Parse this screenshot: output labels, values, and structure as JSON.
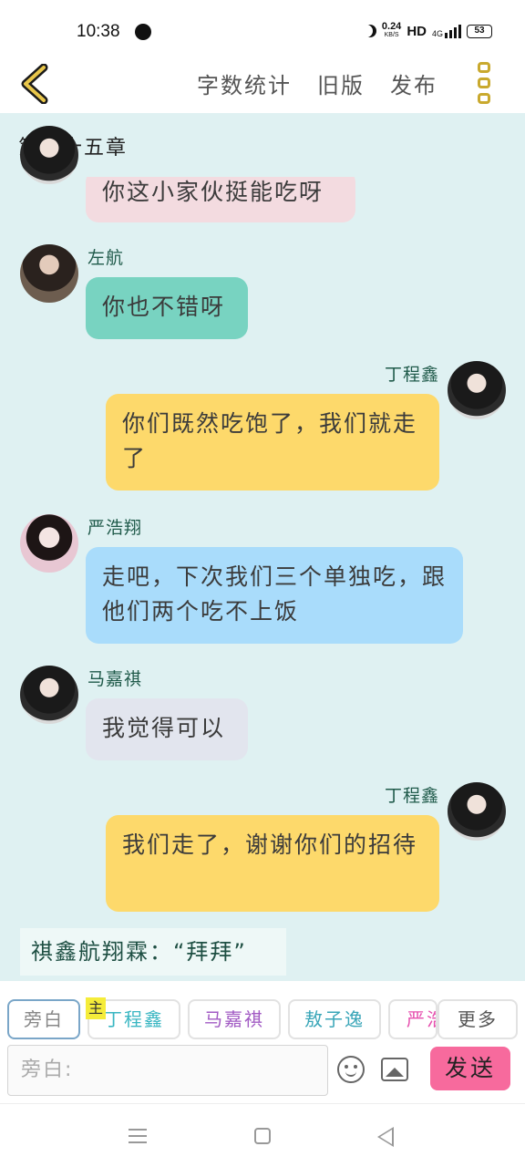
{
  "status_bar": {
    "time": "10:38",
    "net_speed": "0.24",
    "net_unit": "KB/S",
    "hd": "HD",
    "network": "4G",
    "battery": "53"
  },
  "top_bar": {
    "word_count_label": "字数统计",
    "old_version_label": "旧版",
    "publish_label": "发布"
  },
  "chat": {
    "chapter_title": "第三十五章",
    "messages": [
      {
        "speaker": "",
        "text": "你这小家伙挺能吃呀",
        "color": "#f3dbe0"
      },
      {
        "speaker": "左航",
        "text": "你也不错呀",
        "color": "#78d3c1"
      },
      {
        "speaker": "丁程鑫",
        "text": "你们既然吃饱了，我们就走了",
        "color": "#fdd96b"
      },
      {
        "speaker": "严浩翔",
        "text": "走吧，下次我们三个单独吃，跟他们两个吃不上饭",
        "color": "#a9dcfb"
      },
      {
        "speaker": "马嘉祺",
        "text": "我觉得可以",
        "color": "#e2e5ee"
      },
      {
        "speaker": "丁程鑫",
        "text": "我们走了，谢谢你们的招待",
        "color": "#fdd96b"
      }
    ],
    "narration": "祺鑫航翔霖：“拜拜”"
  },
  "role_bar": {
    "narrator": "旁白",
    "main_badge": "主",
    "roles": [
      "丁程鑫",
      "马嘉祺",
      "敖子逸",
      "严浩翔"
    ],
    "more": "更多"
  },
  "input_bar": {
    "placeholder": "旁白:",
    "send_label": "发送"
  }
}
